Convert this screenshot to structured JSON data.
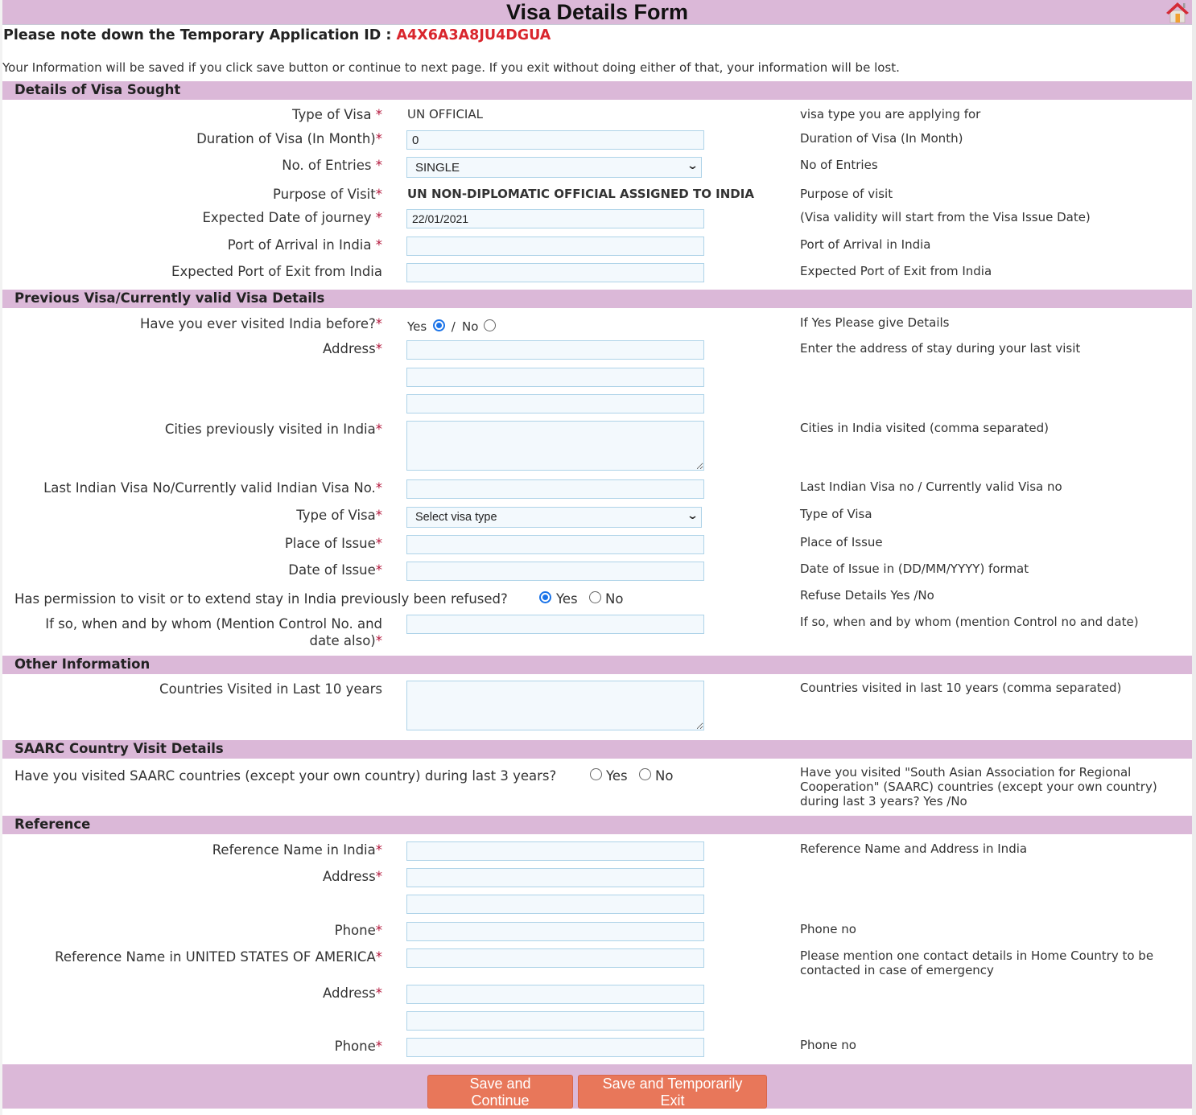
{
  "header": {
    "title": "Visa Details Form",
    "home_icon": "home-icon",
    "app_id_label": "Please note down the Temporary Application ID : ",
    "app_id": "A4X6A3A8JU4DGUA",
    "notice": "Your Information will be saved if you click save button or continue to next page. If you exit without doing either of that, your information will be lost."
  },
  "colors": {
    "section_bg": "#dbb8d8",
    "app_id": "#d9262d",
    "required": "#b3163b",
    "button_bg": "#e8775a",
    "input_bg": "#f3f9fd",
    "input_border": "#aed3e8",
    "radio_accent": "#1a73e8"
  },
  "visa_sought": {
    "heading": "Details of Visa Sought",
    "type_of_visa": {
      "label": "Type of Visa ",
      "value": "UN OFFICIAL",
      "help": "visa type you are applying for"
    },
    "duration": {
      "label": "Duration of Visa (In Month)",
      "value": "0",
      "help": "Duration of Visa (In Month)"
    },
    "entries": {
      "label": "No. of Entries ",
      "value": "SINGLE",
      "help": "No of Entries"
    },
    "purpose": {
      "label": "Purpose of Visit",
      "value": "UN NON-DIPLOMATIC OFFICIAL ASSIGNED TO INDIA",
      "help": "Purpose of visit"
    },
    "journey_date": {
      "label": "Expected Date of journey ",
      "value": "22/01/2021",
      "help": "(Visa validity will start from the Visa Issue Date)"
    },
    "port_arrival": {
      "label": "Port of Arrival in India ",
      "value": "",
      "help": "Port of Arrival in India"
    },
    "port_exit": {
      "label": "Expected Port of Exit from India",
      "value": "",
      "help": "Expected Port of Exit from India"
    }
  },
  "previous_visa": {
    "heading": "Previous Visa/Currently valid Visa Details",
    "visited_before": {
      "label": "Have you ever visited India before?",
      "yes": "Yes",
      "sep": " / ",
      "no": "No",
      "selected": "Yes",
      "help": "If Yes Please give Details"
    },
    "address": {
      "label": "Address",
      "line1": "",
      "line2": "",
      "line3": "",
      "help": "Enter the address of stay during your last visit"
    },
    "cities": {
      "label": "Cities previously visited in India",
      "value": "",
      "help": "Cities in India visited (comma separated)"
    },
    "last_visa_no": {
      "label": "Last Indian Visa No/Currently valid Indian Visa No.",
      "value": "",
      "help": "Last Indian Visa no / Currently valid Visa no"
    },
    "visa_type": {
      "label": "Type of Visa",
      "value": "Select visa type",
      "help": "Type of Visa"
    },
    "place_issue": {
      "label": "Place of Issue",
      "value": "",
      "help": "Place of Issue"
    },
    "date_issue": {
      "label": "Date of Issue",
      "value": "",
      "help": "Date of Issue in (DD/MM/YYYY) format"
    },
    "refused": {
      "label": "Has permission to visit or to extend stay in India previously been refused?",
      "yes": "Yes",
      "no": "No",
      "selected": "Yes",
      "help": "Refuse Details Yes /No"
    },
    "refused_details": {
      "label_line1": "If so, when and by whom (Mention Control No. and",
      "label_line2": "date also)",
      "value": "",
      "help": "If so, when and by whom (mention Control no and date)"
    }
  },
  "other_info": {
    "heading": "Other Information",
    "countries": {
      "label": "Countries Visited in Last 10 years",
      "value": "",
      "help": "Countries visited in last 10 years (comma separated)"
    }
  },
  "saarc": {
    "heading": "SAARC Country Visit Details",
    "question": {
      "label": "Have you visited SAARC countries (except your own country) during last 3 years?",
      "yes": "Yes",
      "no": "No",
      "selected": null,
      "help": "Have you visited \"South Asian Association for Regional Cooperation\" (SAARC) countries (except your own country) during last 3 years? Yes /No"
    }
  },
  "reference": {
    "heading": "Reference",
    "india_name": {
      "label": "Reference Name in India",
      "value": "",
      "help": "Reference Name and Address in India"
    },
    "india_address": {
      "label": "Address",
      "line1": "",
      "line2": ""
    },
    "india_phone": {
      "label": "Phone",
      "value": "",
      "help": "Phone no"
    },
    "home_name": {
      "label": "Reference Name in UNITED STATES OF AMERICA",
      "value": "",
      "help": "Please mention one contact details in Home Country to be contacted in case of emergency"
    },
    "home_address": {
      "label": "Address",
      "line1": "",
      "line2": ""
    },
    "home_phone": {
      "label": "Phone",
      "value": "",
      "help": "Phone no"
    }
  },
  "required_mark": "*",
  "footer": {
    "save_continue": "Save and Continue",
    "save_exit": "Save and Temporarily Exit"
  }
}
